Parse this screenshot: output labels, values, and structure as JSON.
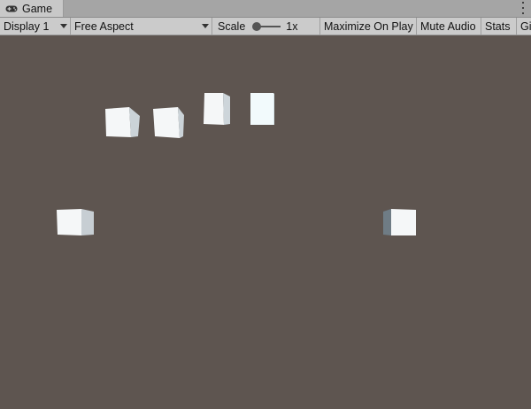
{
  "tab": {
    "label": "Game",
    "icon": "gamepad-icon"
  },
  "toolbar": {
    "display": "Display 1",
    "aspect": "Free Aspect",
    "scale_label": "Scale",
    "scale_value": "1x",
    "maximize": "Maximize On Play",
    "mute": "Mute Audio",
    "stats": "Stats",
    "gizmos": "Gi"
  },
  "viewport": {
    "background": "#5e5550"
  }
}
